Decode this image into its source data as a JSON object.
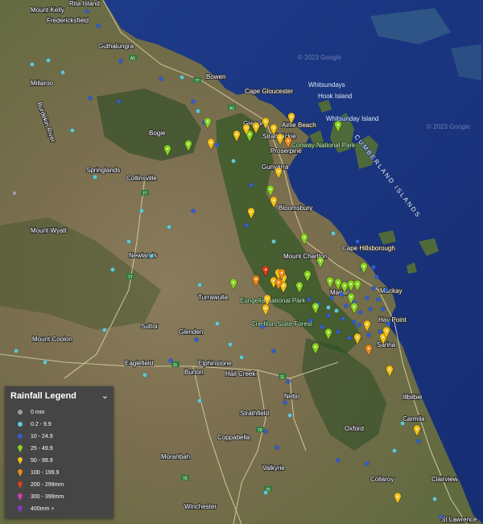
{
  "map": {
    "copyright": "© 2023 Google",
    "places": [
      "Rita Island",
      "Mount Kelly",
      "Fredericksfield",
      "Guthalungra",
      "Bowen",
      "Millaroo",
      "Burdekin River",
      "Bogie",
      "Springlands",
      "Collinsville",
      "Mount Wyatt",
      "Newlands",
      "Turrawulla",
      "Suttor",
      "Glenden",
      "Mount Coolon",
      "Eaglefield",
      "Burton",
      "Elphinstone",
      "Hail Creek",
      "Nebo",
      "Strathfield",
      "Coppabella",
      "Oxford",
      "Moranbah",
      "Valkyrie",
      "Winchester",
      "Collaroy",
      "Clairview",
      "Carmila",
      "Illbilbie",
      "Sarina",
      "Hay Point",
      "Mackay",
      "Marian",
      "Mount Charlton",
      "Cape Hillsborough",
      "Bloomsbury",
      "Gunyarra",
      "Proserpine",
      "Strathdickie",
      "Airlie Beach",
      "Cape Gloucester",
      "Gregory",
      "Whitsundays",
      "Hook Island",
      "Whitsunday Island",
      "St Lawrence"
    ],
    "parks": [
      "Conway National Park",
      "Eungella National Park",
      "Crediton State Forest"
    ],
    "island_label": "CUMBERLAND ISLANDS",
    "road_numbers": [
      "A1",
      "77",
      "77",
      "77",
      "77",
      "11",
      "11",
      "70",
      "70",
      "70",
      "A1"
    ],
    "marker_colors": {
      "gray": "#9e9e9e",
      "cyan": "#5fc9d6",
      "blue": "#2f5fd0",
      "green": "#8ad321",
      "yellow": "#f2c21b",
      "orange": "#f08a1c",
      "red": "#d8401a",
      "magenta": "#d03ab8",
      "purple": "#8a35c8"
    }
  },
  "legend": {
    "title": "Rainfall Legend",
    "toggle": "⌄",
    "items": [
      {
        "label": "0 mm",
        "color": "#9e9e9e",
        "icon": "dot"
      },
      {
        "label": "0.2 - 9.9",
        "color": "#5fc9d6",
        "icon": "dot"
      },
      {
        "label": "10 - 24.9",
        "color": "#2f5fd0",
        "icon": "dot"
      },
      {
        "label": "25 - 49.9",
        "color": "#8ad321",
        "icon": "pin"
      },
      {
        "label": "50 - 99.9",
        "color": "#f2c21b",
        "icon": "pin"
      },
      {
        "label": "100 - 199.9",
        "color": "#f08a1c",
        "icon": "pin"
      },
      {
        "label": "200 - 299mm",
        "color": "#d8401a",
        "icon": "pin"
      },
      {
        "label": "300 - 399mm",
        "color": "#d03ab8",
        "icon": "pin"
      },
      {
        "label": "400mm +",
        "color": "#8a35c8",
        "icon": "pin"
      }
    ]
  }
}
